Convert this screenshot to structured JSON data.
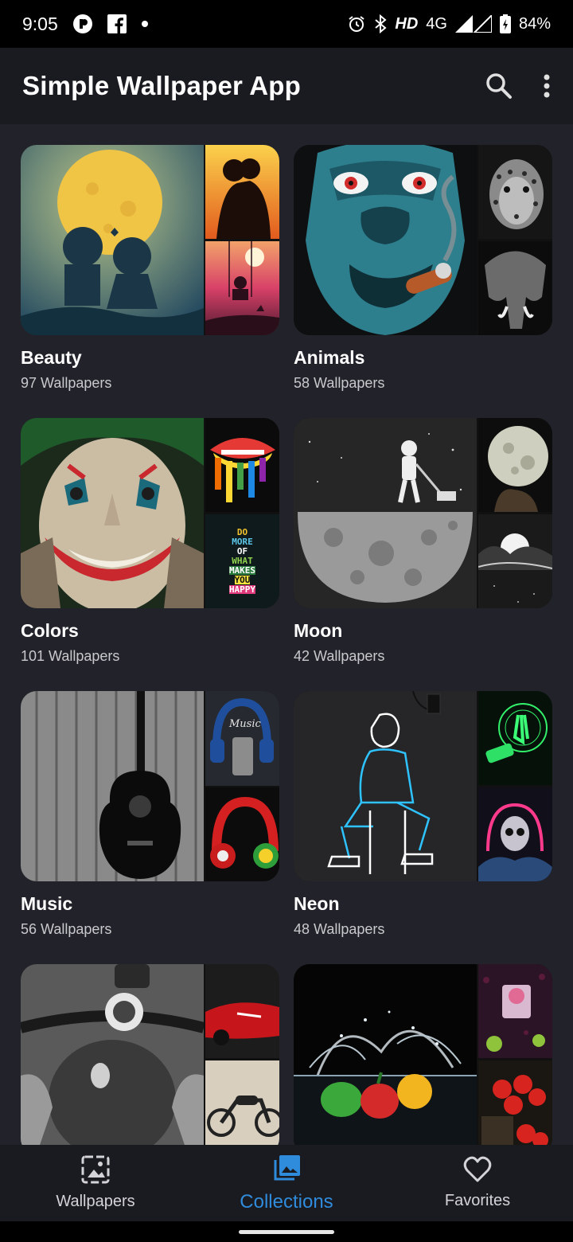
{
  "status": {
    "time": "9:05",
    "network_hd": "HD",
    "network_type": "4G",
    "battery": "84%",
    "icons": [
      "notification-icon",
      "facebook-icon",
      "dot-icon",
      "alarm-icon",
      "bluetooth-icon",
      "signal-icon",
      "battery-icon"
    ]
  },
  "app": {
    "title": "Simple Wallpaper App",
    "actions": [
      "search-icon",
      "more-vert-icon"
    ]
  },
  "collections": [
    {
      "name": "Beauty",
      "count": "97 Wallpapers"
    },
    {
      "name": "Animals",
      "count": "58 Wallpapers"
    },
    {
      "name": "Colors",
      "count": "101 Wallpapers"
    },
    {
      "name": "Moon",
      "count": "42 Wallpapers"
    },
    {
      "name": "Music",
      "count": "56 Wallpapers"
    },
    {
      "name": "Neon",
      "count": "48 Wallpapers"
    },
    {
      "name": "",
      "count": ""
    },
    {
      "name": "",
      "count": ""
    }
  ],
  "thumb_texts": {
    "colors_quote": [
      "DO",
      "MORE",
      "OF",
      "WHAT",
      "MAKES",
      "YOU",
      "HAPPY"
    ],
    "music_headphone": "Music"
  },
  "nav": {
    "items": [
      {
        "label": "Wallpapers",
        "icon": "wallpaper-icon",
        "active": false
      },
      {
        "label": "Collections",
        "icon": "collections-icon",
        "active": true
      },
      {
        "label": "Favorites",
        "icon": "favorite-icon",
        "active": false
      }
    ]
  },
  "colors": {
    "accent": "#2f8bdc",
    "background": "#22232a",
    "bar": "#1a1b20"
  }
}
